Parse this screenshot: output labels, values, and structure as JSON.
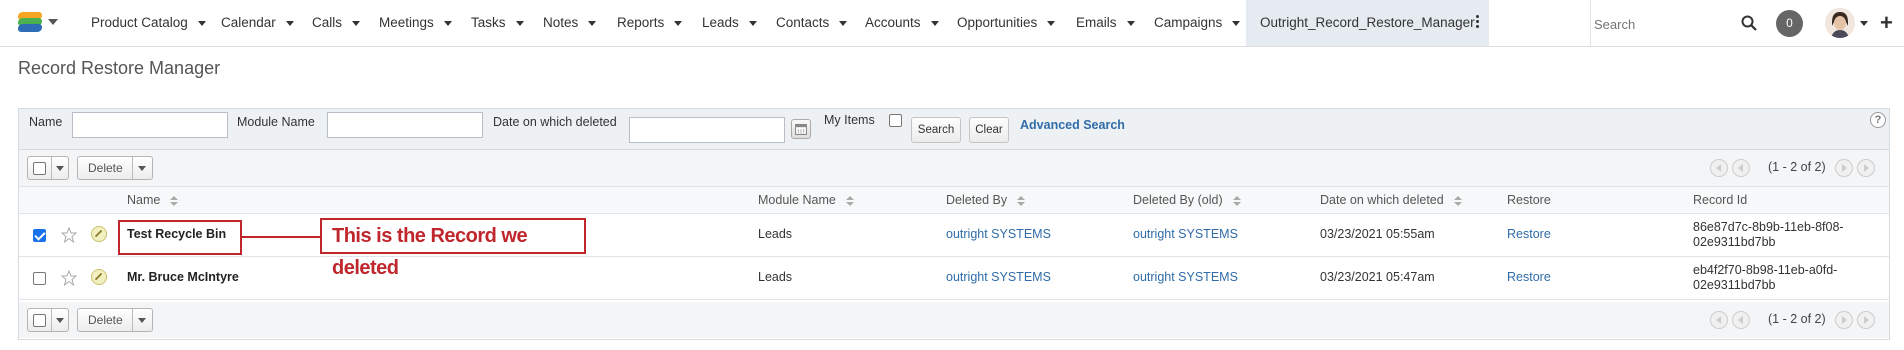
{
  "nav": {
    "items": [
      {
        "label": "Product Catalog"
      },
      {
        "label": "Calendar"
      },
      {
        "label": "Calls"
      },
      {
        "label": "Meetings"
      },
      {
        "label": "Tasks"
      },
      {
        "label": "Notes"
      },
      {
        "label": "Reports"
      },
      {
        "label": "Leads"
      },
      {
        "label": "Contacts"
      },
      {
        "label": "Accounts"
      },
      {
        "label": "Opportunities"
      },
      {
        "label": "Emails"
      },
      {
        "label": "Campaigns"
      }
    ],
    "active_item": "Outright_Record_Restore_Manager",
    "search_placeholder": "Search",
    "notification_count": "0"
  },
  "page": {
    "title": "Record Restore Manager"
  },
  "search_form": {
    "name_label": "Name",
    "name_value": "",
    "module_label": "Module Name",
    "module_value": "",
    "date_label": "Date on which deleted",
    "date_value": "",
    "my_items_label": "My Items",
    "search_button": "Search",
    "clear_button": "Clear",
    "advanced_link": "Advanced Search",
    "help_icon": "?"
  },
  "list": {
    "delete_label": "Delete",
    "pagination_text": "(1 - 2 of 2)",
    "columns": [
      "Name",
      "Module Name",
      "Deleted By",
      "Deleted By (old)",
      "Date on which deleted",
      "Restore",
      "Record Id"
    ],
    "rows": [
      {
        "checked": true,
        "name": "Test Recycle Bin",
        "module": "Leads",
        "deleted_by": "outright SYSTEMS",
        "deleted_by_old": "outright SYSTEMS",
        "date": "03/23/2021 05:55am",
        "restore": "Restore",
        "record_id": "86e87d7c-8b9b-11eb-8f08-02e9311bd7bb"
      },
      {
        "checked": false,
        "name": "Mr. Bruce McIntyre",
        "module": "Leads",
        "deleted_by": "outright SYSTEMS",
        "deleted_by_old": "outright SYSTEMS",
        "date": "03/23/2021 05:47am",
        "restore": "Restore",
        "record_id": "eb4f2f70-8b98-11eb-a0fd-02e9311bd7bb"
      }
    ]
  },
  "annotation": {
    "text": "This is the Record we deleted",
    "color": "#c0272d"
  },
  "colors": {
    "link": "#2f6ca8",
    "checkbox_checked": "#1a73e8",
    "active_tab_bg": "#e5ebf0"
  }
}
